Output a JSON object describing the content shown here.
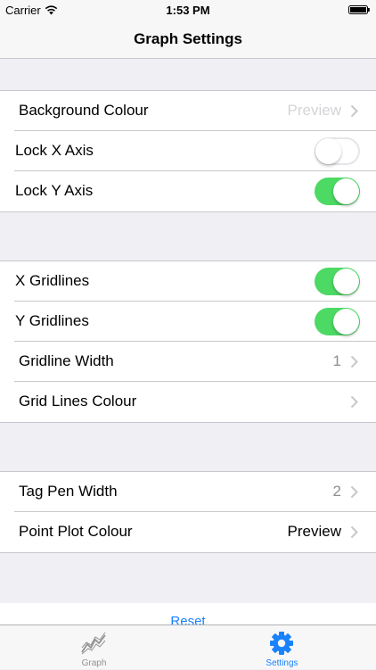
{
  "status_bar": {
    "carrier": "Carrier",
    "time": "1:53 PM",
    "wifi_icon": "wifi-icon",
    "battery_icon": "battery-icon"
  },
  "nav": {
    "title": "Graph Settings"
  },
  "groups": [
    {
      "rows": [
        {
          "label": "Background Colour",
          "value": "Preview",
          "accessory": "chevron"
        },
        {
          "label": "Lock X Axis",
          "toggle": false
        },
        {
          "label": "Lock Y Axis",
          "toggle": true
        }
      ]
    },
    {
      "rows": [
        {
          "label": "X Gridlines",
          "toggle": true
        },
        {
          "label": "Y Gridlines",
          "toggle": true
        },
        {
          "label": "Gridline Width",
          "value": "1",
          "accessory": "chevron"
        },
        {
          "label": "Grid Lines Colour",
          "value": "",
          "accessory": "chevron"
        }
      ]
    },
    {
      "rows": [
        {
          "label": "Tag Pen Width",
          "value": "2",
          "accessory": "chevron"
        },
        {
          "label": "Point Plot Colour",
          "value": "Preview",
          "accessory": "chevron"
        }
      ]
    }
  ],
  "reset": {
    "label": "Reset"
  },
  "tabs": [
    {
      "label": "Graph",
      "icon": "graph-icon",
      "active": false
    },
    {
      "label": "Settings",
      "icon": "gear-icon",
      "active": true
    }
  ],
  "colors": {
    "accent": "#1a82fb",
    "toggle_on": "#4cd964",
    "group_background": "#efeff4"
  }
}
